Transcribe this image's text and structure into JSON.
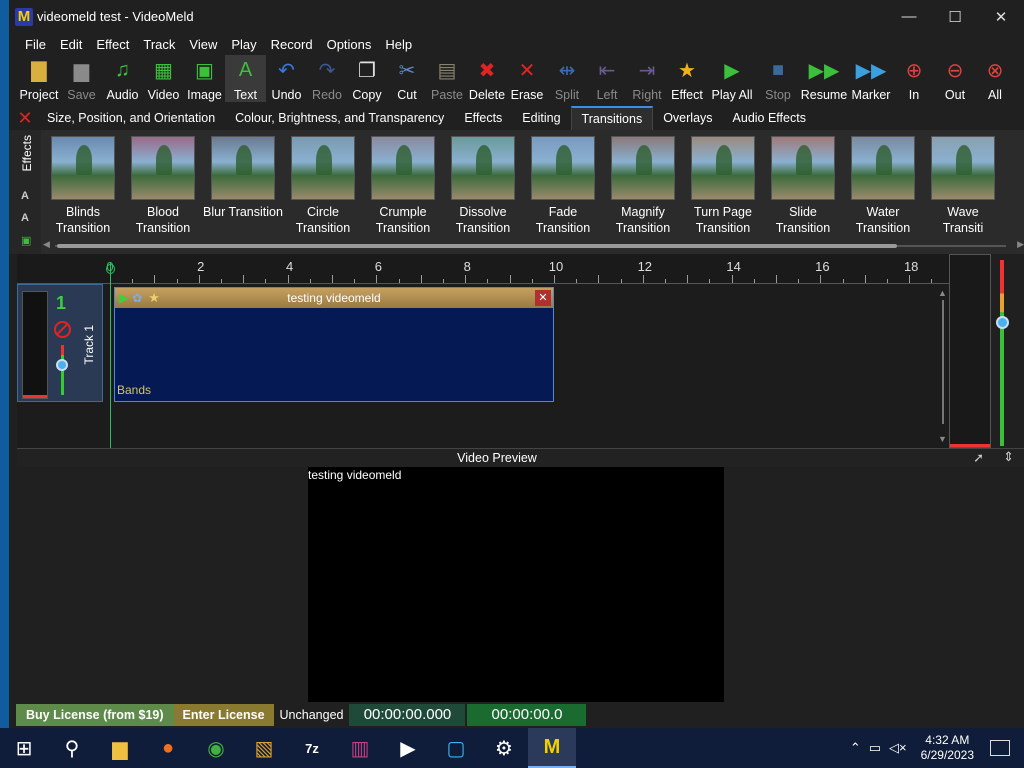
{
  "window": {
    "title": "videomeld test - VideoMeld",
    "controls": [
      "—",
      "☐",
      "✕"
    ]
  },
  "menu": [
    "File",
    "Edit",
    "Effect",
    "Track",
    "View",
    "Play",
    "Record",
    "Options",
    "Help"
  ],
  "toolbar": [
    {
      "label": "Project",
      "icon": "folder-icon",
      "glyph": "▇",
      "color": "#d8b040",
      "enabled": true
    },
    {
      "label": "Save",
      "icon": "save-icon",
      "glyph": "▆",
      "color": "#8a8a8a",
      "enabled": false
    },
    {
      "label": "Audio",
      "icon": "add-audio-icon",
      "glyph": "♫",
      "color": "#3cc03c",
      "enabled": true
    },
    {
      "label": "Video",
      "icon": "add-video-icon",
      "glyph": "▦",
      "color": "#3cc03c",
      "enabled": true
    },
    {
      "label": "Image",
      "icon": "add-image-icon",
      "glyph": "▣",
      "color": "#3cc03c",
      "enabled": true
    },
    {
      "label": "Text",
      "icon": "add-text-icon",
      "glyph": "A",
      "color": "#3cc03c",
      "enabled": true
    },
    {
      "label": "Undo",
      "icon": "undo-icon",
      "glyph": "↶",
      "color": "#3a7ae0",
      "enabled": true
    },
    {
      "label": "Redo",
      "icon": "redo-icon",
      "glyph": "↷",
      "color": "#3a5a90",
      "enabled": false
    },
    {
      "label": "Copy",
      "icon": "copy-icon",
      "glyph": "❐",
      "color": "#e0e0e0",
      "enabled": true
    },
    {
      "label": "Cut",
      "icon": "cut-icon",
      "glyph": "✂",
      "color": "#5a8ac0",
      "enabled": true
    },
    {
      "label": "Paste",
      "icon": "paste-icon",
      "glyph": "▤",
      "color": "#8a8070",
      "enabled": false
    },
    {
      "label": "Delete",
      "icon": "delete-icon",
      "glyph": "✖",
      "color": "#e02424",
      "enabled": true
    },
    {
      "label": "Erase",
      "icon": "erase-icon",
      "glyph": "✕",
      "color": "#e02424",
      "enabled": true
    },
    {
      "label": "Split",
      "icon": "split-icon",
      "glyph": "⇹",
      "color": "#3a6ab0",
      "enabled": false
    },
    {
      "label": "Left",
      "icon": "trim-left-icon",
      "glyph": "⇤",
      "color": "#6a5a90",
      "enabled": false
    },
    {
      "label": "Right",
      "icon": "trim-right-icon",
      "glyph": "⇥",
      "color": "#6a5a90",
      "enabled": false
    },
    {
      "label": "Effect",
      "icon": "effect-star-icon",
      "glyph": "★",
      "color": "#f0b020",
      "enabled": true
    },
    {
      "label": "Play All",
      "icon": "play-all-icon",
      "glyph": "▶",
      "color": "#3cc03c",
      "enabled": true
    },
    {
      "label": "Stop",
      "icon": "stop-icon",
      "glyph": "■",
      "color": "#3a6a9a",
      "enabled": false
    },
    {
      "label": "Resume",
      "icon": "resume-icon",
      "glyph": "▶▶",
      "color": "#3cc03c",
      "enabled": true
    },
    {
      "label": "Marker",
      "icon": "marker-icon",
      "glyph": "▶▶",
      "color": "#3aa0e0",
      "enabled": true
    },
    {
      "label": "In",
      "icon": "zoom-in-icon",
      "glyph": "⊕",
      "color": "#e04040",
      "enabled": true
    },
    {
      "label": "Out",
      "icon": "zoom-out-icon",
      "glyph": "⊖",
      "color": "#e04040",
      "enabled": true
    },
    {
      "label": "All",
      "icon": "zoom-all-icon",
      "glyph": "⊗",
      "color": "#e04040",
      "enabled": true
    }
  ],
  "effect_tabs": [
    {
      "label": "Size, Position, and Orientation",
      "active": false
    },
    {
      "label": "Colour, Brightness, and Transparency",
      "active": false
    },
    {
      "label": "Effects",
      "active": false
    },
    {
      "label": "Editing",
      "active": false
    },
    {
      "label": "Transitions",
      "active": true
    },
    {
      "label": "Overlays",
      "active": false
    },
    {
      "label": "Audio Effects",
      "active": false
    }
  ],
  "effects_panel_label": "Effects",
  "transitions": [
    {
      "line1": "Blinds",
      "line2": "Transition"
    },
    {
      "line1": "Blood",
      "line2": "Transition"
    },
    {
      "line1": "Blur Transition",
      "line2": ""
    },
    {
      "line1": "Circle",
      "line2": "Transition"
    },
    {
      "line1": "Crumple",
      "line2": "Transition"
    },
    {
      "line1": "Dissolve",
      "line2": "Transition"
    },
    {
      "line1": "Fade",
      "line2": "Transition"
    },
    {
      "line1": "Magnify",
      "line2": "Transition"
    },
    {
      "line1": "Turn Page",
      "line2": "Transition"
    },
    {
      "line1": "Slide",
      "line2": "Transition"
    },
    {
      "line1": "Water",
      "line2": "Transition"
    },
    {
      "line1": "Wave",
      "line2": "Transiti"
    }
  ],
  "ruler": {
    "labels": [
      "0",
      "2",
      "4",
      "6",
      "8",
      "10",
      "12",
      "14",
      "16",
      "18"
    ]
  },
  "track": {
    "number": "1",
    "name": "Track 1"
  },
  "clip": {
    "title": "testing videomeld",
    "effect": "Bands"
  },
  "preview": {
    "title": "Video Preview",
    "overlay_text": "testing videomeld"
  },
  "status": {
    "buy": "Buy License (from $19)",
    "enter_license": "Enter License",
    "state": "Unchanged",
    "time_position": "00:00:00.000",
    "time_length": "00:00:00.0"
  },
  "taskbar": {
    "apps": [
      "windows-start-icon",
      "search-icon",
      "file-explorer-icon",
      "firefox-icon",
      "chrome-icon",
      "paint-icon",
      "7zip-icon",
      "winrar-icon",
      "media-player-icon",
      "remote-desktop-icon",
      "settings-icon",
      "videomeld-icon"
    ],
    "clock_time": "4:32 AM",
    "clock_date": "6/29/2023"
  }
}
